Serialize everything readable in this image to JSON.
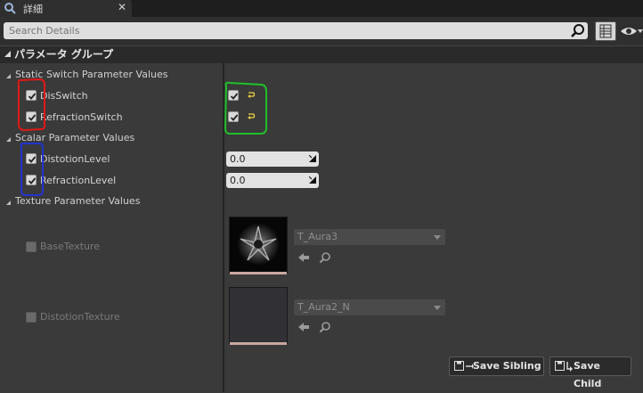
{
  "tab": {
    "label": "詳細",
    "close": "✕"
  },
  "search": {
    "placeholder": "Search Details"
  },
  "group": {
    "title": "パラメータ グループ"
  },
  "categories": {
    "static_switch": {
      "title": "Static Switch Parameter Values",
      "params": [
        {
          "label": "DisSwitch",
          "enabled": true,
          "value": true
        },
        {
          "label": "RefractionSwitch",
          "enabled": true,
          "value": true
        }
      ]
    },
    "scalar": {
      "title": "Scalar Parameter Values",
      "params": [
        {
          "label": "DistotionLevel",
          "enabled": true,
          "value": "0.0"
        },
        {
          "label": "RefractionLevel",
          "enabled": true,
          "value": "0.0"
        }
      ]
    },
    "texture": {
      "title": "Texture Parameter Values",
      "params": [
        {
          "label": "BaseTexture",
          "enabled": false,
          "asset": "T_Aura3"
        },
        {
          "label": "DistotionTexture",
          "enabled": false,
          "asset": "T_Aura2_N"
        }
      ]
    }
  },
  "buttons": {
    "save_sibling": "Save Sibling",
    "save_child": "Save Child"
  },
  "icons": {
    "search": "search-icon",
    "grid": "grid-view-icon",
    "eye": "eye-icon",
    "reset": "reset-arrow-icon",
    "use_asset": "arrow-left-icon",
    "browse": "magnifier-icon",
    "save": "floppy-disk-icon"
  },
  "annotation_colors": {
    "red": "#e01818",
    "green": "#1fbf2a",
    "blue": "#2233d0",
    "reset_yellow": "#f0d040"
  }
}
